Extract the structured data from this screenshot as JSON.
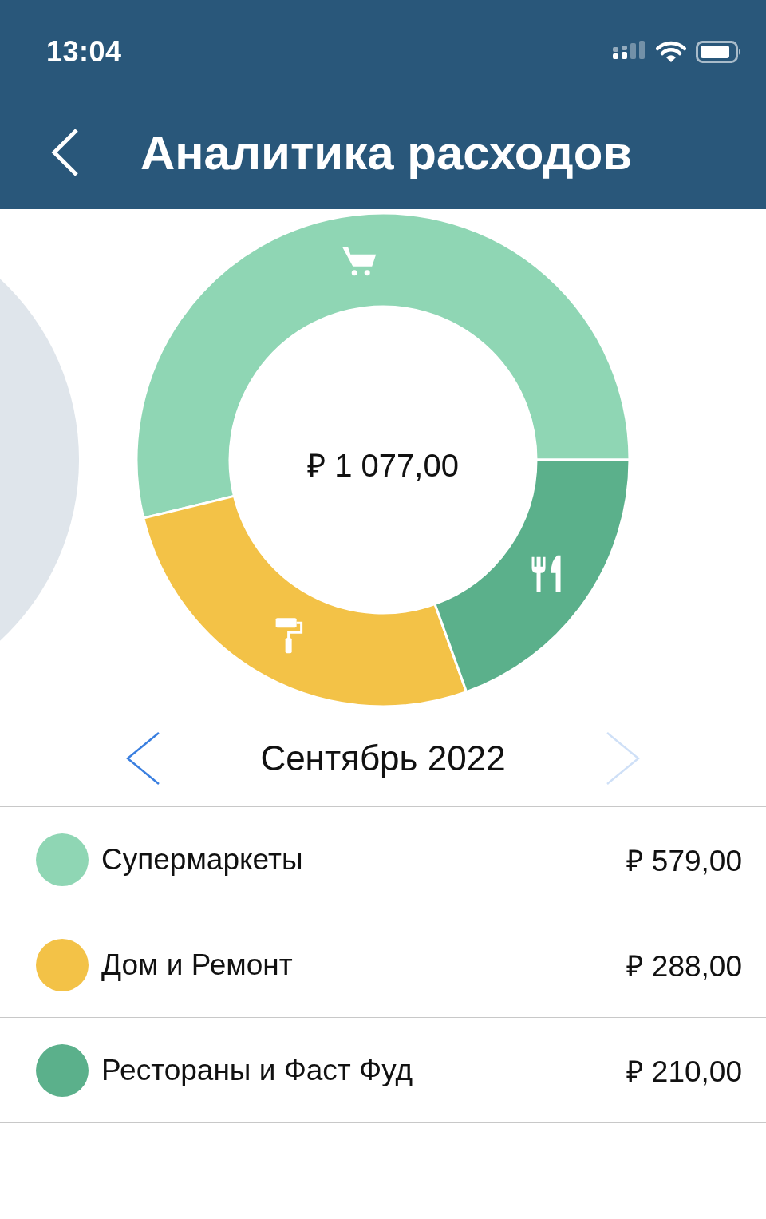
{
  "status_bar": {
    "time": "13:04"
  },
  "header": {
    "title": "Аналитика расходов"
  },
  "chart": {
    "total": "₽ 1 077,00",
    "chart_data": {
      "type": "donut",
      "values": [
        53.8,
        26.7,
        19.5
      ]
    }
  },
  "month_nav": {
    "label": "Сентябрь 2022",
    "prev_disabled": false,
    "next_disabled": true
  },
  "categories": [
    {
      "name": "Супермаркеты",
      "amount": "₽ 579,00",
      "color": "#8fd6b4"
    },
    {
      "name": "Дом и Ремонт",
      "amount": "₽ 288,00",
      "color": "#f3c247"
    },
    {
      "name": "Рестораны и Фаст Фуд",
      "amount": "₽ 210,00",
      "color": "#5bb08b"
    }
  ]
}
